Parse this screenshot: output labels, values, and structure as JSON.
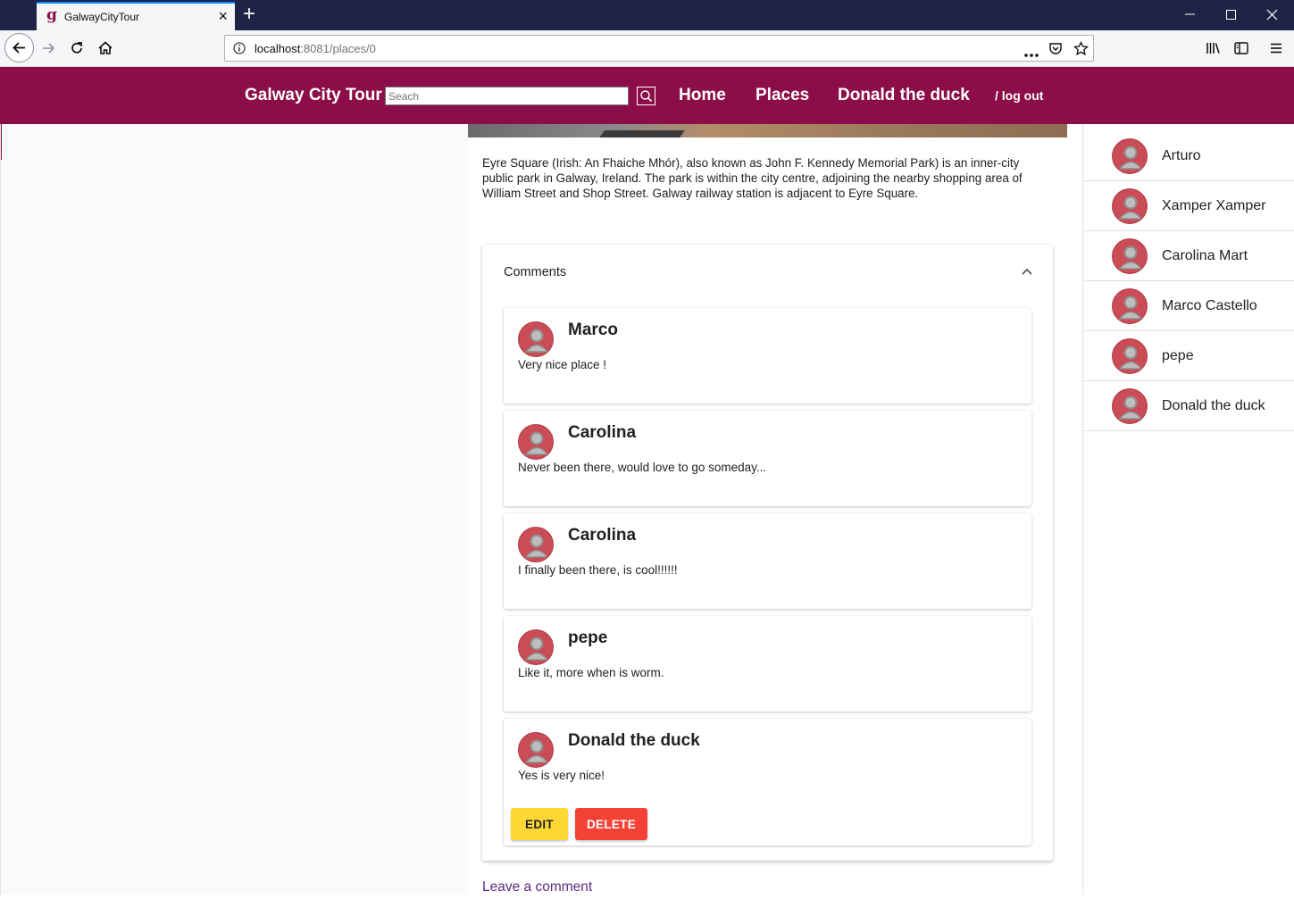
{
  "browser": {
    "tab_title": "GalwayCityTour",
    "tab_favicon": "g",
    "url_host": "localhost",
    "url_rest": ":8081/places/0",
    "window_controls": {
      "minimize": "—",
      "maximize": "☐",
      "close": "✕"
    }
  },
  "header": {
    "brand": "Galway City Tour",
    "search_placeholder": "Seach",
    "nav": {
      "home": "Home",
      "places": "Places",
      "user": "Donald the duck"
    },
    "logout": "/ log out",
    "color": "#8c0e48"
  },
  "place": {
    "description": "Eyre Square (Irish: An Fhaiche Mhór), also known as John F. Kennedy Memorial Park) is an inner-city public park in Galway, Ireland. The park is within the city centre, adjoining the nearby shopping area of William Street and Shop Street. Galway railway station is adjacent to Eyre Square."
  },
  "comments": {
    "title": "Comments",
    "items": [
      {
        "author": "Marco",
        "text": "Very nice place !"
      },
      {
        "author": "Carolina",
        "text": "Never been there, would love to go someday..."
      },
      {
        "author": "Carolina",
        "text": "I finally been there, is cool!!!!!!"
      },
      {
        "author": "pepe",
        "text": "Like it, more when is worm."
      },
      {
        "author": "Donald the duck",
        "text": "Yes is very nice!"
      }
    ],
    "edit_label": "EDIT",
    "delete_label": "DELETE",
    "leave_comment": "Leave a comment"
  },
  "users": [
    {
      "name": "Arturo"
    },
    {
      "name": "Xamper Xamper"
    },
    {
      "name": "Carolina Mart"
    },
    {
      "name": "Marco Castello"
    },
    {
      "name": "pepe"
    },
    {
      "name": "Donald the duck"
    }
  ]
}
